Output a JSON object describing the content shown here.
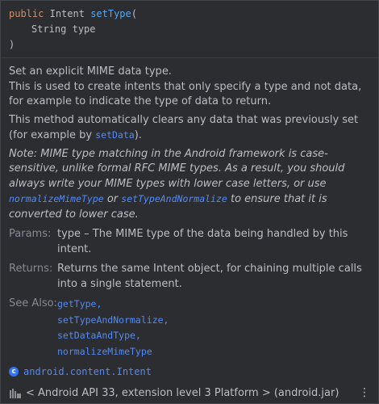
{
  "signature": {
    "modifier": "public",
    "return_type": "Intent",
    "method_name": "setType",
    "open_paren": "(",
    "param_type": "String",
    "param_name": "type",
    "close_paren": ")"
  },
  "description": {
    "line1": "Set an explicit MIME data type.",
    "line2": "This is used to create intents that only specify a type and not data, for example to indicate the type of data to return.",
    "p2_text": "This method automatically clears any data that was previously set (for example by ",
    "p2_link": "setData",
    "p2_end": ").",
    "note_part1": "Note: MIME type matching in the Android framework is case-sensitive, unlike formal RFC MIME types. As a result, you should always write your MIME types with lower case letters, or use ",
    "note_link1": "normalizeMimeType",
    "note_part2": " or ",
    "note_link2": "setTypeAndNormalize",
    "note_part3": " to ensure that it is converted to lower case."
  },
  "params": {
    "label": "Params:",
    "text": "type – The MIME type of the data being handled by this intent."
  },
  "returns": {
    "label": "Returns:",
    "text": "Returns the same Intent object, for chaining multiple calls into a single statement."
  },
  "see_also": {
    "label": "See Also:",
    "items": [
      "getType,",
      "setTypeAndNormalize,",
      "setDataAndType,",
      "normalizeMimeType"
    ]
  },
  "class_ref": {
    "icon_letter": "c",
    "name": "android.content.Intent"
  },
  "library": {
    "text": "< Android API 33, extension level 3 Platform > (android.jar)"
  },
  "more_icon": "more-vertical-icon",
  "colors": {
    "background": "#2b2d30",
    "keyword": "#cf8e6d",
    "method": "#56a8f5",
    "link": "#548af7",
    "label": "#868a91"
  }
}
